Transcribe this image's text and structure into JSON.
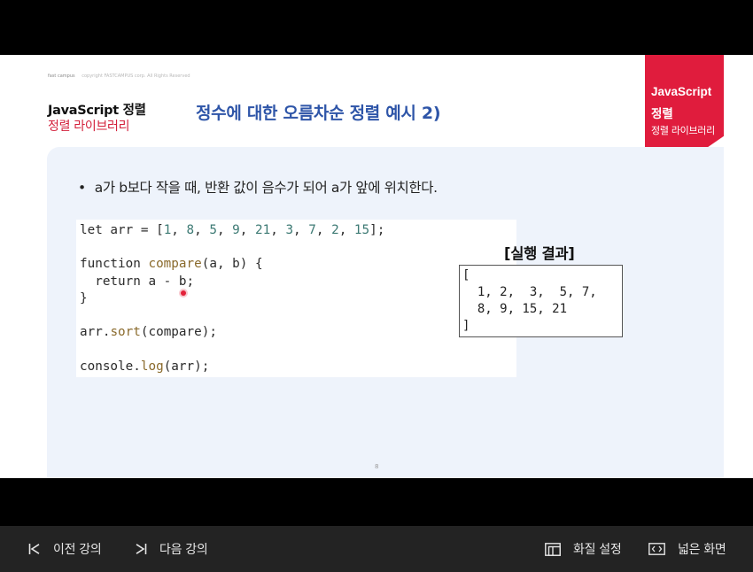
{
  "brand": {
    "logo": "fast campus",
    "copyright": "copyright FASTCAMPUS corp. All Rights Reserved"
  },
  "course": {
    "title": "JavaScript 정렬",
    "subtitle": "정렬 라이브러리"
  },
  "slide_title": "정수에 대한 오름차순 정렬 예시 2)",
  "ribbon": {
    "line1": "JavaScript",
    "line2": "정렬",
    "line3": "정렬 라이브러리"
  },
  "bullet": "a가 b보다 작을 때, 반환 값이 음수가 되어 a가 앞에 위치한다.",
  "code": {
    "line1": {
      "decl": "let arr = [",
      "n1": "1",
      "n2": "8",
      "n3": "5",
      "n4": "9",
      "n5": "21",
      "n6": "3",
      "n7": "7",
      "n8": "2",
      "n9": "15",
      "end": "];",
      "sep": ", "
    },
    "line2": {
      "kw": "function ",
      "fn": "compare",
      "rest": "(a, b) {"
    },
    "line3": "  return a - b;",
    "line4": "}",
    "line5": {
      "obj": "arr.",
      "fn": "sort",
      "rest": "(compare);"
    },
    "line6": {
      "obj": "console.",
      "fn": "log",
      "rest": "(arr);"
    }
  },
  "result": {
    "title": "[실행 결과]",
    "text": "[\n  1, 2,  3,  5, 7,\n  8, 9, 15, 21\n]"
  },
  "page_number": "8",
  "controls": {
    "prev": "이전 강의",
    "next": "다음 강의",
    "quality": "화질 설정",
    "wide": "넓은 화면"
  },
  "colors": {
    "accent_red": "#e01c3d",
    "title_blue": "#2e55a8",
    "content_bg": "#eef3fb",
    "control_bar": "#232323"
  }
}
